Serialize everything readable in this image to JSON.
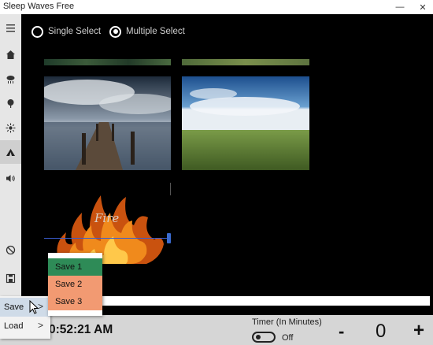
{
  "app": {
    "title": "Sleep Waves Free"
  },
  "window_controls": {
    "minimize": "—",
    "maximize": "☐",
    "close": "✕"
  },
  "rail": {
    "items": [
      {
        "icon": "hamburger-icon"
      },
      {
        "icon": "home-icon"
      },
      {
        "icon": "rain-cloud-icon"
      },
      {
        "icon": "tree-icon"
      },
      {
        "icon": "sun-icon"
      },
      {
        "icon": "tent-icon",
        "active": true
      },
      {
        "icon": "speaker-icon"
      },
      {
        "icon": "block-icon"
      },
      {
        "icon": "save-icon"
      }
    ]
  },
  "select_mode": {
    "single_label": "Single Select",
    "multiple_label": "Multiple Select",
    "selected": "multiple"
  },
  "tiles": {
    "fire_label": "Fire"
  },
  "context_menu": {
    "save_label": "Save",
    "load_label": "Load",
    "chevron": ">"
  },
  "save_submenu": {
    "items": [
      {
        "label": "Save 1",
        "color": "#2e8b57"
      },
      {
        "label": "Save 2",
        "color": "#f29a72"
      },
      {
        "label": "Save 3",
        "color": "#f29a72"
      }
    ]
  },
  "bottom_bar": {
    "clock": "0:52:21 AM",
    "timer_label": "Timer (In Minutes)",
    "toggle_state": "Off",
    "minus_label": "-",
    "timer_value": "0",
    "plus_label": "+"
  },
  "colors": {
    "accent": "#3a6bd0",
    "rail_bg": "#e6e6e6",
    "bottom_bg": "#d6d6d6"
  }
}
